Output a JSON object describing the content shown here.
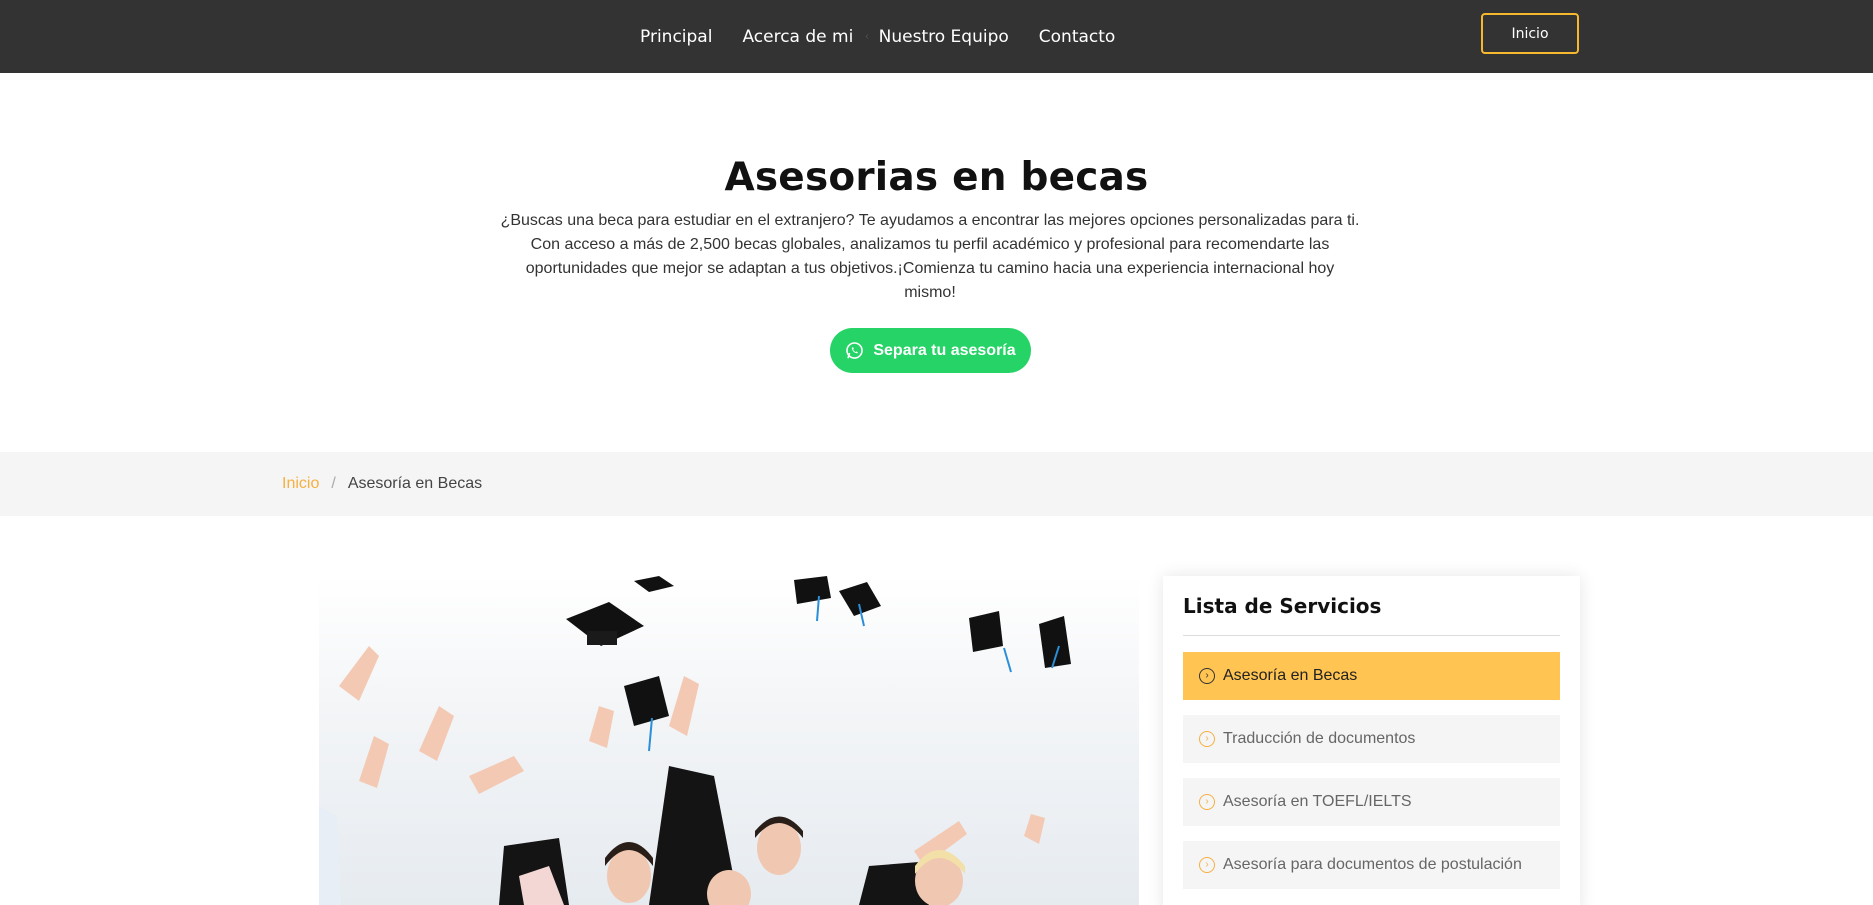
{
  "nav": {
    "links": [
      "Principal",
      "Acerca de mi",
      "Nuestro Equipo",
      "Contacto"
    ],
    "separator": "‹",
    "button_label": "Inicio"
  },
  "hero": {
    "title": "Asesorias en becas",
    "description": "¿Buscas una beca para estudiar en el extranjero? Te ayudamos a encontrar las mejores opciones personalizadas para ti. Con acceso a más de 2,500 becas globales, analizamos tu perfil académico y profesional para recomendarte las oportunidades que mejor se adaptan a tus objetivos.¡Comienza tu camino hacia una experiencia internacional hoy mismo!",
    "cta_label": "Separa tu asesoría",
    "cta_icon": "whatsapp-icon"
  },
  "breadcrumb": {
    "home": "Inicio",
    "separator": "/",
    "current": "Asesoría en Becas"
  },
  "sidebar": {
    "title": "Lista de Servicios",
    "items": [
      {
        "label": "Asesoría en Becas",
        "active": true
      },
      {
        "label": "Traducción de documentos",
        "active": false
      },
      {
        "label": "Asesoría en TOEFL/IELTS",
        "active": false
      },
      {
        "label": "Asesoría para documentos de postulación",
        "active": false
      }
    ],
    "item_icon": "arrow-right-circle-icon"
  },
  "colors": {
    "navbar": "#333333",
    "accent": "#ffc451",
    "cta_green": "#25d366",
    "breadcrumb_home": "#f5b041"
  }
}
